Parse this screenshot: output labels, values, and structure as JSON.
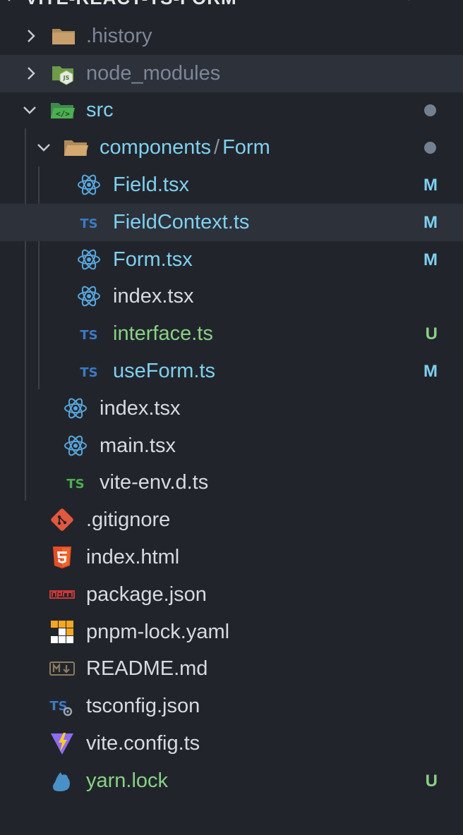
{
  "header": {
    "title": "VITE-REACT-TS-FORM",
    "actions": [
      {
        "icon": "new-file-icon"
      },
      {
        "icon": "new-folder-icon"
      },
      {
        "icon": "refresh-icon"
      },
      {
        "icon": "collapse-all-icon"
      }
    ]
  },
  "colors": {
    "default_text": "#d7dae0",
    "modified_text": "#7fd0f0",
    "untracked_text": "#89d185",
    "ignored_text": "#7d8799",
    "modified_badge": "#7fd0f0",
    "untracked_badge": "#89d185"
  },
  "tree": {
    "history": {
      "label": ".history",
      "icon": "folder-icon"
    },
    "node_modules": {
      "label": "node_modules",
      "icon": "nodejs-folder-icon"
    },
    "src": {
      "label": "src",
      "icon": "src-folder-icon"
    },
    "components": {
      "label_part1": "components",
      "separator": "/",
      "label_part2": "Form",
      "icon": "folder-open-icon"
    },
    "field_tsx": {
      "label": "Field.tsx",
      "icon": "react-icon",
      "badge": "M"
    },
    "field_context_ts": {
      "label": "FieldContext.ts",
      "icon": "typescript-icon",
      "badge": "M"
    },
    "form_tsx": {
      "label": "Form.tsx",
      "icon": "react-icon",
      "badge": "M"
    },
    "form_index_tsx": {
      "label": "index.tsx",
      "icon": "react-icon"
    },
    "interface_ts": {
      "label": "interface.ts",
      "icon": "typescript-icon",
      "badge": "U"
    },
    "use_form_ts": {
      "label": "useForm.ts",
      "icon": "typescript-icon",
      "badge": "M"
    },
    "src_index_tsx": {
      "label": "index.tsx",
      "icon": "react-icon"
    },
    "main_tsx": {
      "label": "main.tsx",
      "icon": "react-icon"
    },
    "vite_env": {
      "label": "vite-env.d.ts",
      "icon": "typescript-def-icon"
    },
    "gitignore": {
      "label": ".gitignore",
      "icon": "git-icon"
    },
    "index_html": {
      "label": "index.html",
      "icon": "html5-icon"
    },
    "package_json": {
      "label": "package.json",
      "icon": "npm-icon"
    },
    "pnpm_lock": {
      "label": "pnpm-lock.yaml",
      "icon": "pnpm-icon"
    },
    "readme": {
      "label": "README.md",
      "icon": "markdown-icon"
    },
    "tsconfig": {
      "label": "tsconfig.json",
      "icon": "tsconfig-icon"
    },
    "vite_config": {
      "label": "vite.config.ts",
      "icon": "vite-icon"
    },
    "yarn_lock": {
      "label": "yarn.lock",
      "icon": "yarn-icon",
      "badge": "U"
    }
  }
}
